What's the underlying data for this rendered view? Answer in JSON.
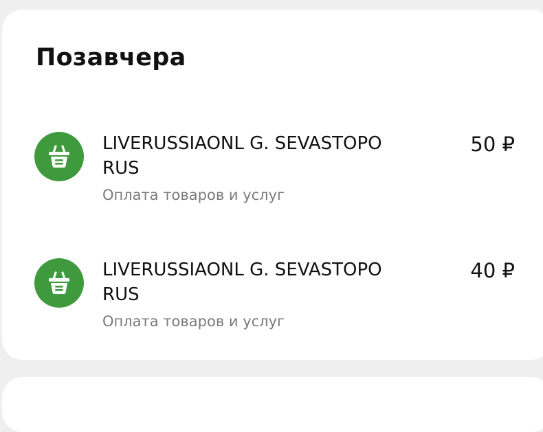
{
  "section": {
    "title": "Позавчера"
  },
  "colors": {
    "icon_bg": "#3f9a3d",
    "card": "#ffffff",
    "page": "#efefef"
  },
  "transactions": [
    {
      "icon": "shopping-basket-icon",
      "name": "LIVERUSSIAONL G. SEVASTOPO RUS",
      "category": "Оплата товаров и услуг",
      "amount": "50 ₽"
    },
    {
      "icon": "shopping-basket-icon",
      "name": "LIVERUSSIAONL G. SEVASTOPO RUS",
      "category": "Оплата товаров и услуг",
      "amount": "40 ₽"
    }
  ]
}
